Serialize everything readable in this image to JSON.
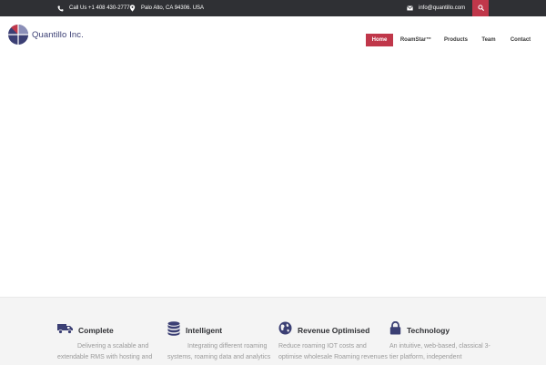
{
  "topbar": {
    "phone": "Call Us +1 408 430-2777",
    "address": "Palo Alto, CA 94306. USA",
    "email": "info@quantillo.com",
    "icons": {
      "phone": "phone-icon",
      "location": "map-marker-icon",
      "email": "envelope-icon",
      "search": "search-icon"
    }
  },
  "brand": {
    "name": "Quantillo Inc.",
    "accent": "#c0374a",
    "primary": "#3b3f74",
    "topbar_bg": "#2f3034"
  },
  "nav": {
    "items": [
      {
        "label": "Home",
        "active": true
      },
      {
        "label": "RoamStar™",
        "active": false
      },
      {
        "label": "Products",
        "active": false
      },
      {
        "label": "Team",
        "active": false
      },
      {
        "label": "Contact",
        "active": false
      }
    ]
  },
  "features": [
    {
      "icon": "truck-icon",
      "title": "Complete",
      "desc": "Delivering a scalable and extendable RMS with hosting and outsourcing services"
    },
    {
      "icon": "database-icon",
      "title": "Intelligent",
      "desc": "Integrating different roaming systems, roaming data and analytics"
    },
    {
      "icon": "globe-icon",
      "title": "Revenue Optimised",
      "desc": "Reduce roaming IOT costs and optimise wholesale Roaming revenues"
    },
    {
      "icon": "lock-icon",
      "title": "Technology",
      "desc": "An intuitive, web-based, classical 3-tier platform, independent"
    }
  ]
}
